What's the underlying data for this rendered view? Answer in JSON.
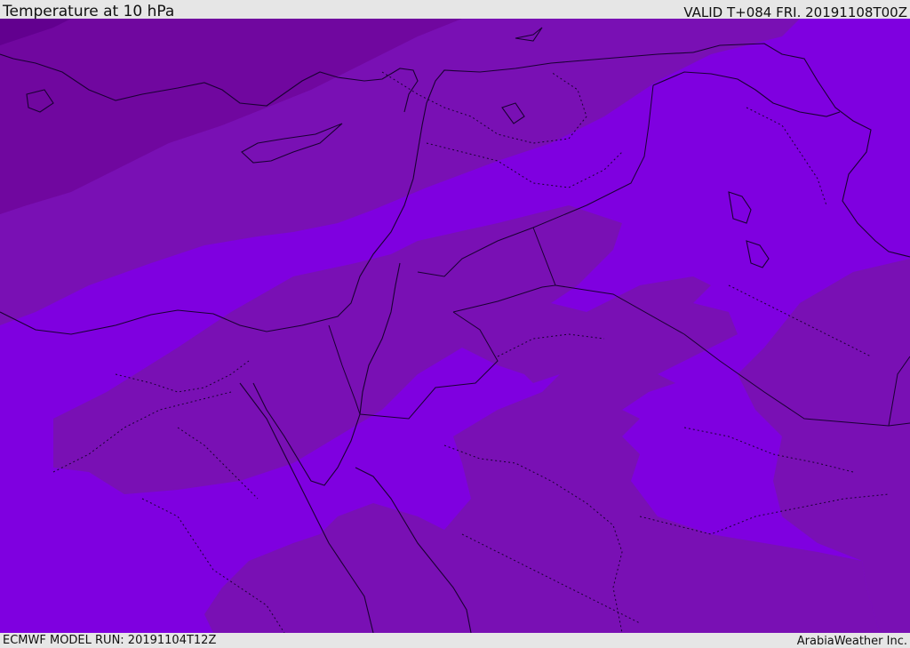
{
  "header": {
    "title": "Temperature at 10 hPa",
    "valid": "VALID T+084 FRI. 20191108T00Z"
  },
  "footer": {
    "model_run": "ECMWF MODEL RUN: 20191104T12Z",
    "credit": "ArabiaWeather Inc."
  },
  "map": {
    "colors": {
      "band_warmest": "#7f00e0",
      "band_mid": "#7910b4",
      "band_cool": "#70079f",
      "band_coldest": "#62008f",
      "coast": "#1a0033"
    }
  }
}
